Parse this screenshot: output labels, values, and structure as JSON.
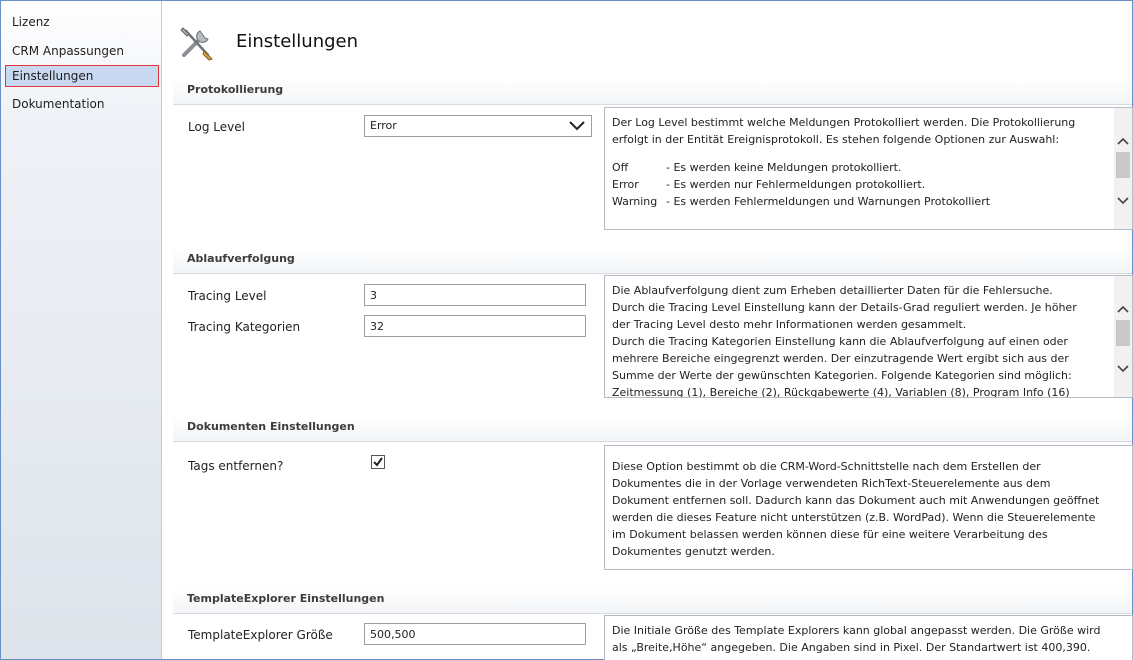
{
  "sidebar": {
    "items": [
      {
        "label": "Lizenz"
      },
      {
        "label": "CRM Anpassungen"
      },
      {
        "label": "Einstellungen"
      },
      {
        "label": "Dokumentation"
      }
    ]
  },
  "page": {
    "title": "Einstellungen",
    "icon": "tools-icon"
  },
  "sections": {
    "protokollierung": {
      "title": "Protokollierung",
      "log_level_label": "Log Level",
      "log_level_value": "Error",
      "desc_lines": [
        "Der Log Level bestimmt welche Meldungen Protokolliert werden. Die Protokollierung",
        "erfolgt in der Entität Ereignisprotokoll. Es stehen folgende Optionen zur Auswahl:"
      ],
      "options": [
        {
          "key": "Off",
          "text": "-  Es werden keine Meldungen protokolliert."
        },
        {
          "key": "Error",
          "text": "-  Es werden nur Fehlermeldungen protokolliert."
        },
        {
          "key": "Warning",
          "text": "-  Es werden Fehlermeldungen und Warnungen Protokolliert"
        }
      ]
    },
    "ablaufverfolgung": {
      "title": "Ablaufverfolgung",
      "tracing_level_label": "Tracing Level",
      "tracing_level_value": "3",
      "tracing_kategorien_label": "Tracing Kategorien",
      "tracing_kategorien_value": "32",
      "desc_lines": [
        "Die Ablaufverfolgung dient zum Erheben detaillierter Daten für die Fehlersuche.",
        "Durch die Tracing Level Einstellung kann der Details-Grad reguliert werden. Je höher",
        "der Tracing Level desto mehr Informationen werden gesammelt.",
        "Durch die Tracing Kategorien Einstellung kann die Ablaufverfolgung auf einen oder",
        "mehrere Bereiche eingegrenzt werden. Der einzutragende Wert ergibt sich aus der",
        "Summe der Werte der gewünschten Kategorien. Folgende Kategorien sind möglich:",
        "Zeitmessung (1), Bereiche (2), Rückgabewerte (4), Variablen (8), Program Info (16)"
      ]
    },
    "dokumente": {
      "title": "Dokumenten Einstellungen",
      "tags_label": "Tags entfernen?",
      "tags_checked": true,
      "desc_lines": [
        "Diese Option bestimmt ob die CRM-Word-Schnittstelle nach dem Erstellen der",
        "Dokumentes die in der Vorlage verwendeten RichText-Steuerelemente aus dem",
        "Dokument entfernen soll. Dadurch kann das Dokument auch mit Anwendungen geöffnet",
        "werden die dieses Feature nicht unterstützen (z.B. WordPad). Wenn die Steuerelemente",
        "im Dokument belassen werden können diese für eine weitere Verarbeitung des",
        "Dokumentes genutzt werden."
      ]
    },
    "templateexplorer": {
      "title": "TemplateExplorer Einstellungen",
      "size_label": "TemplateExplorer Größe",
      "size_value": "500,500",
      "desc_lines": [
        "Die Initiale Größe des Template Explorers kann global angepasst werden. Die Größe wird",
        "als „Breite,Höhe“ angegeben. Die Angaben sind in Pixel. Der Standartwert ist 400,390."
      ]
    }
  },
  "colors": {
    "sidebar_active_bg": "#c7d8f0",
    "sidebar_active_border": "#e2353c",
    "frame_border": "#6a8fc7"
  }
}
